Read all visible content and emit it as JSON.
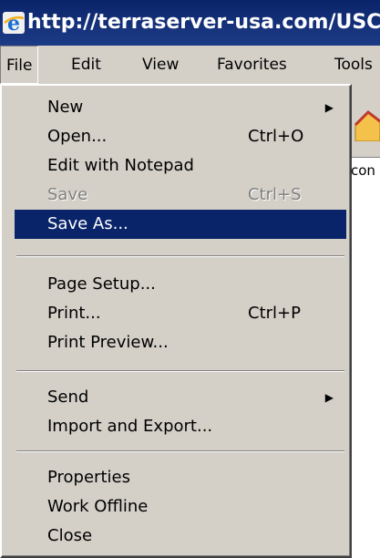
{
  "window": {
    "title": "http://terraserver-usa.com/USC"
  },
  "menubar": {
    "items": [
      "File",
      "Edit",
      "View",
      "Favorites",
      "Tools"
    ]
  },
  "address": {
    "partial_text": "con"
  },
  "file_menu": {
    "items": [
      {
        "label": "New",
        "shortcut": "",
        "submenu": true,
        "disabled": false
      },
      {
        "label": "Open...",
        "shortcut": "Ctrl+O",
        "submenu": false,
        "disabled": false
      },
      {
        "label": "Edit with Notepad",
        "shortcut": "",
        "submenu": false,
        "disabled": false
      },
      {
        "label": "Save",
        "shortcut": "Ctrl+S",
        "submenu": false,
        "disabled": true
      },
      {
        "label": "Save As...",
        "shortcut": "",
        "submenu": false,
        "disabled": false,
        "selected": true
      },
      {
        "label": "Page Setup...",
        "shortcut": "",
        "submenu": false,
        "disabled": false
      },
      {
        "label": "Print...",
        "shortcut": "Ctrl+P",
        "submenu": false,
        "disabled": false
      },
      {
        "label": "Print Preview...",
        "shortcut": "",
        "submenu": false,
        "disabled": false
      },
      {
        "label": "Send",
        "shortcut": "",
        "submenu": true,
        "disabled": false
      },
      {
        "label": "Import and Export...",
        "shortcut": "",
        "submenu": false,
        "disabled": false
      },
      {
        "label": "Properties",
        "shortcut": "",
        "submenu": false,
        "disabled": false
      },
      {
        "label": "Work Offline",
        "shortcut": "",
        "submenu": false,
        "disabled": false
      },
      {
        "label": "Close",
        "shortcut": "",
        "submenu": false,
        "disabled": false
      }
    ]
  },
  "colors": {
    "title_bar": "#0a246a",
    "menu_bg": "#d4d0c8",
    "selection": "#0a246a"
  },
  "icons": {
    "title": "internet-explorer-icon",
    "submenu": "submenu-arrow-icon"
  }
}
